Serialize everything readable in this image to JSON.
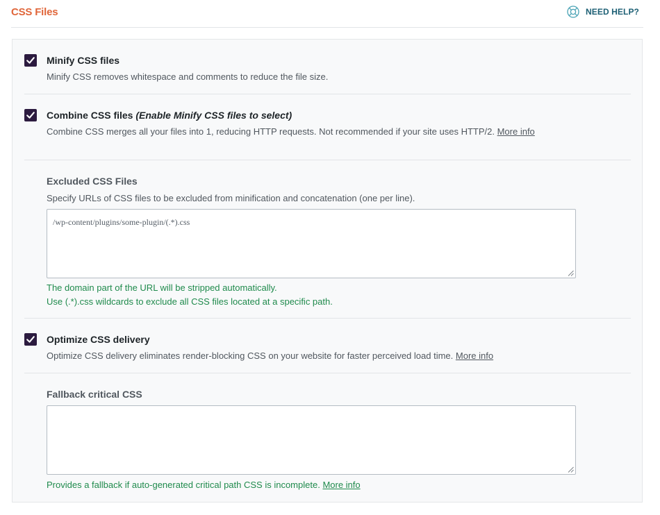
{
  "header": {
    "title": "CSS Files",
    "help_label": "NEED HELP?"
  },
  "options": {
    "minify": {
      "checked": true,
      "title": "Minify CSS files",
      "description": "Minify CSS removes whitespace and comments to reduce the file size."
    },
    "combine": {
      "checked": true,
      "title": "Combine CSS files",
      "title_note": "(Enable Minify CSS files to select)",
      "description": "Combine CSS merges all your files into 1, reducing HTTP requests. Not recommended if your site uses HTTP/2.",
      "link": "More info"
    },
    "excluded": {
      "title": "Excluded CSS Files",
      "description": "Specify URLs of CSS files to be excluded from minification and concatenation (one per line).",
      "value": "/wp-content/plugins/some-plugin/(.*).css",
      "help_line1": "The domain part of the URL will be stripped automatically.",
      "help_line2": "Use (.*).css wildcards to exclude all CSS files located at a specific path."
    },
    "optimize": {
      "checked": true,
      "title": "Optimize CSS delivery",
      "description": "Optimize CSS delivery eliminates render-blocking CSS on your website for faster perceived load time.",
      "link": "More info"
    },
    "fallback": {
      "title": "Fallback critical CSS",
      "value": "",
      "help": "Provides a fallback if auto-generated critical path CSS is incomplete.",
      "link": "More info"
    }
  },
  "colors": {
    "title": "#e0663a",
    "help": "#1c5f74",
    "checkbox": "#2c1b3f",
    "help_text": "#1f8a4c"
  },
  "icons": {
    "help": "lifebuoy-icon",
    "check": "check-icon",
    "resize": "resize-grip-icon"
  }
}
